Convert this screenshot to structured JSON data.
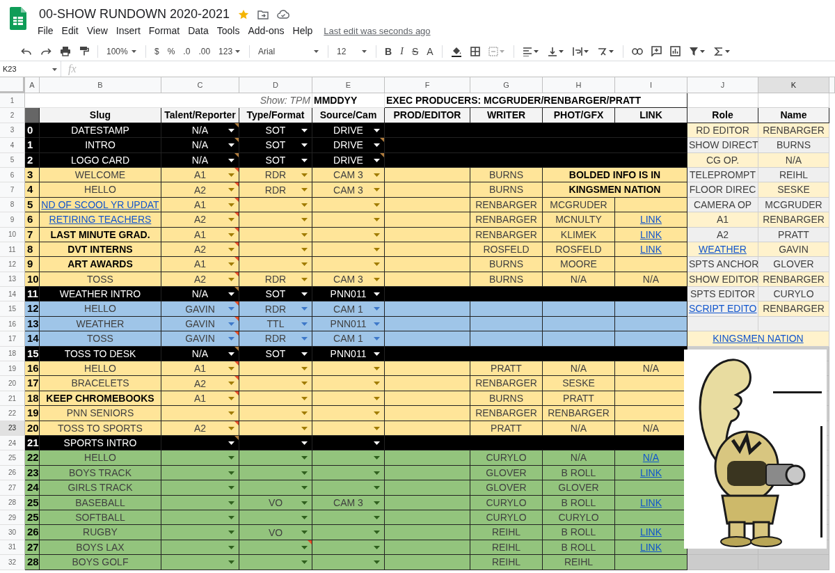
{
  "document": {
    "title": "00-SHOW RUNDOWN 2020-2021",
    "starred": true,
    "last_edit": "Last edit was seconds ago"
  },
  "menu": [
    "File",
    "Edit",
    "View",
    "Insert",
    "Format",
    "Data",
    "Tools",
    "Add-ons",
    "Help"
  ],
  "toolbar": {
    "zoom": "100%",
    "currency": "$",
    "percent": "%",
    "decrease_decimals": ".0",
    "increase_decimals": ".00",
    "more_formats": "123",
    "font": "Arial",
    "font_size": "12",
    "bold": "B",
    "italic": "I",
    "strikethrough": "S",
    "text_color": "A"
  },
  "formula_bar": {
    "cell": "K23",
    "fx": "fx"
  },
  "columns": [
    {
      "label": "A",
      "selected": false
    },
    {
      "label": "B",
      "selected": false
    },
    {
      "label": "C",
      "selected": false
    },
    {
      "label": "D",
      "selected": false
    },
    {
      "label": "E",
      "selected": false
    },
    {
      "label": "F",
      "selected": false
    },
    {
      "label": "G",
      "selected": false
    },
    {
      "label": "H",
      "selected": false
    },
    {
      "label": "I",
      "selected": false
    },
    {
      "label": "J",
      "selected": false
    },
    {
      "label": "K",
      "selected": true
    }
  ],
  "title_row": {
    "row": "1",
    "show_label": "Show: TPM",
    "date": "MMDDYY",
    "producers": "EXEC PRODUCERS: MCGRUDER/RENBARGER/PRATT"
  },
  "header_row": {
    "row": "2",
    "headings": [
      "Slug",
      "Talent/Reporter",
      "Type/Format",
      "Source/Cam",
      "PROD/EDITOR",
      "WRITER",
      "PHOT/GFX",
      "LINK",
      "Role",
      "Name"
    ]
  },
  "rows": [
    {
      "row": "3",
      "selected": false,
      "kind": "section",
      "number": "0",
      "slug": {
        "text": "DATESTAMP",
        "kind": "plain"
      },
      "talent": {
        "value": "N/A",
        "flagged": true
      },
      "type": {
        "value": "SOT",
        "flagged": false
      },
      "source": {
        "value": "DRIVE",
        "flagged": false
      },
      "staff": {
        "role": {
          "text": "RD EDITOR",
          "linked": false,
          "color": "#fff2cc"
        },
        "name": {
          "text": "RENBARGER",
          "color": "#fff2cc"
        }
      }
    },
    {
      "row": "4",
      "selected": false,
      "kind": "section",
      "number": "1",
      "slug": {
        "text": "INTRO",
        "kind": "plain"
      },
      "talent": {
        "value": "N/A",
        "flagged": true
      },
      "type": {
        "value": "SOT",
        "flagged": false
      },
      "source": {
        "value": "DRIVE",
        "flagged": true
      },
      "staff": {
        "role": {
          "text": "SHOW DIRECT",
          "linked": false,
          "color": "#efefef"
        },
        "name": {
          "text": "BURNS",
          "color": "#efefef"
        }
      }
    },
    {
      "row": "5",
      "selected": false,
      "kind": "section",
      "number": "2",
      "slug": {
        "text": "LOGO CARD",
        "kind": "plain"
      },
      "talent": {
        "value": "N/A",
        "flagged": true
      },
      "type": {
        "value": "SOT",
        "flagged": false
      },
      "source": {
        "value": "DRIVE",
        "flagged": true
      },
      "staff": {
        "role": {
          "text": "CG OP.",
          "linked": false,
          "color": "#fff2cc"
        },
        "name": {
          "text": "N/A",
          "color": "#fff2cc"
        }
      }
    },
    {
      "row": "6",
      "selected": false,
      "kind": "yellow",
      "number": "3",
      "slug": {
        "text": "WELCOME",
        "kind": "plain"
      },
      "talent": {
        "value": "A1",
        "flagged": true
      },
      "type": {
        "value": "RDR",
        "flagged": false
      },
      "source": {
        "value": "CAM 3",
        "flagged": false
      },
      "writer": "BURNS",
      "banner": "BOLDED INFO IS IN",
      "staff": {
        "role": {
          "text": "TELEPROMPT",
          "linked": false,
          "color": "#efefef"
        },
        "name": {
          "text": "REIHL",
          "color": "#efefef"
        }
      }
    },
    {
      "row": "7",
      "selected": false,
      "kind": "yellow",
      "number": "4",
      "slug": {
        "text": "HELLO",
        "kind": "plain"
      },
      "talent": {
        "value": "A2",
        "flagged": true
      },
      "type": {
        "value": "RDR",
        "flagged": false
      },
      "source": {
        "value": "CAM 3",
        "flagged": false
      },
      "writer": "BURNS",
      "banner": "KINGSMEN NATION",
      "staff": {
        "role": {
          "text": "FLOOR DIREC",
          "linked": false,
          "color": "#efefef"
        },
        "name": {
          "text": "SESKE",
          "color": "#fff2cc"
        }
      }
    },
    {
      "row": "8",
      "selected": false,
      "kind": "yellow",
      "number": "5",
      "slug": {
        "text": "ND OF SCOOL YR UPDAT",
        "kind": "link"
      },
      "talent": {
        "value": "A1",
        "flagged": true
      },
      "type": {
        "flagged": false
      },
      "source": {
        "flagged": false
      },
      "writer": "RENBARGER",
      "phot": "MCGRUDER",
      "staff": {
        "role": {
          "text": "CAMERA OP",
          "linked": false,
          "color": "#efefef"
        },
        "name": {
          "text": "MCGRUDER",
          "color": "#efefef"
        }
      }
    },
    {
      "row": "9",
      "selected": false,
      "kind": "yellow",
      "number": "6",
      "slug": {
        "text": "RETIRING TEACHERS",
        "kind": "link"
      },
      "talent": {
        "value": "A2",
        "flagged": true
      },
      "type": {
        "flagged": false
      },
      "source": {
        "flagged": false
      },
      "writer": "RENBARGER",
      "phot": "MCNULTY",
      "link": {
        "text": "LINK",
        "linked": true
      },
      "staff": {
        "role": {
          "text": "A1",
          "linked": false,
          "color": "#fff2cc"
        },
        "name": {
          "text": "RENBARGER",
          "color": "#fff2cc"
        }
      }
    },
    {
      "row": "10",
      "selected": false,
      "kind": "yellow",
      "number": "7",
      "slug": {
        "text": "LAST MINUTE GRAD.",
        "kind": "bold"
      },
      "talent": {
        "value": "A1",
        "flagged": true
      },
      "type": {
        "flagged": false
      },
      "source": {
        "flagged": false
      },
      "writer": "RENBARGER",
      "phot": "KLIMEK",
      "link": {
        "text": "LINK",
        "linked": true
      },
      "staff": {
        "role": {
          "text": "A2",
          "linked": false,
          "color": "#efefef"
        },
        "name": {
          "text": "PRATT",
          "color": "#efefef"
        }
      }
    },
    {
      "row": "11",
      "selected": false,
      "kind": "yellow",
      "number": "8",
      "slug": {
        "text": "DVT INTERNS",
        "kind": "bold"
      },
      "talent": {
        "value": "A2",
        "flagged": true
      },
      "type": {
        "flagged": false
      },
      "source": {
        "flagged": false
      },
      "writer": "ROSFELD",
      "phot": "ROSFELD",
      "link": {
        "text": "LINK",
        "linked": true
      },
      "staff": {
        "role": {
          "text": "WEATHER",
          "linked": true,
          "color": "#fff2cc"
        },
        "name": {
          "text": "GAVIN",
          "color": "#fff2cc"
        }
      }
    },
    {
      "row": "12",
      "selected": false,
      "kind": "yellow",
      "number": "9",
      "slug": {
        "text": "ART AWARDS",
        "kind": "bold"
      },
      "talent": {
        "value": "A1",
        "flagged": true
      },
      "type": {
        "flagged": false
      },
      "source": {
        "flagged": false
      },
      "writer": "BURNS",
      "phot": "MOORE",
      "staff": {
        "role": {
          "text": "SPTS ANCHOR",
          "linked": false,
          "color": "#efefef"
        },
        "name": {
          "text": "GLOVER",
          "color": "#efefef"
        }
      }
    },
    {
      "row": "13",
      "selected": false,
      "kind": "yellow",
      "number": "10",
      "slug": {
        "text": "TOSS",
        "kind": "plain"
      },
      "talent": {
        "value": "A2",
        "flagged": true
      },
      "type": {
        "value": "RDR",
        "flagged": false
      },
      "source": {
        "value": "CAM 3",
        "flagged": false
      },
      "writer": "BURNS",
      "phot": "N/A",
      "link": {
        "text": "N/A",
        "linked": false
      },
      "staff": {
        "role": {
          "text": "SHOW EDITOR",
          "linked": false,
          "color": "#fff2cc"
        },
        "name": {
          "text": "RENBARGER",
          "color": "#fff2cc"
        }
      }
    },
    {
      "row": "14",
      "selected": false,
      "kind": "section",
      "number": "11",
      "slug": {
        "text": "WEATHER INTRO",
        "kind": "plain"
      },
      "talent": {
        "value": "N/A",
        "flagged": true
      },
      "type": {
        "value": "SOT",
        "flagged": false
      },
      "source": {
        "value": "PNN011",
        "flagged": false
      },
      "staff": {
        "role": {
          "text": "SPTS EDITOR",
          "linked": false,
          "color": "#efefef"
        },
        "name": {
          "text": "CURYLO",
          "color": "#efefef"
        }
      }
    },
    {
      "row": "15",
      "selected": false,
      "kind": "blue",
      "number": "12",
      "slug": {
        "text": "HELLO",
        "kind": "plain"
      },
      "talent": {
        "value": "GAVIN",
        "flagged": true
      },
      "type": {
        "value": "RDR",
        "flagged": false
      },
      "source": {
        "value": "CAM 1",
        "flagged": false
      },
      "staff": {
        "role": {
          "text": "SCRIPT EDITO",
          "linked": true,
          "color": "#efefef"
        },
        "name": {
          "text": "RENBARGER",
          "color": "#fff2cc"
        }
      }
    },
    {
      "row": "16",
      "selected": false,
      "kind": "blue",
      "number": "13",
      "slug": {
        "text": "WEATHER",
        "kind": "plain"
      },
      "talent": {
        "value": "GAVIN",
        "flagged": true
      },
      "type": {
        "value": "TTL",
        "flagged": false
      },
      "source": {
        "value": "PNN011",
        "flagged": false
      },
      "staff": {
        "role": {
          "color": "#efefef"
        },
        "name": {
          "color": "#efefef"
        }
      }
    },
    {
      "row": "17",
      "selected": false,
      "kind": "blue",
      "number": "14",
      "slug": {
        "text": "TOSS",
        "kind": "plain"
      },
      "talent": {
        "value": "GAVIN",
        "flagged": true
      },
      "type": {
        "value": "RDR",
        "flagged": false
      },
      "source": {
        "value": "CAM 1",
        "flagged": false
      },
      "staff_banner": "KINGSMEN NATION"
    },
    {
      "row": "18",
      "selected": false,
      "kind": "section",
      "number": "15",
      "slug": {
        "text": "TOSS TO DESK",
        "kind": "plain"
      },
      "talent": {
        "value": "N/A",
        "flagged": true
      },
      "type": {
        "value": "SOT",
        "flagged": false
      },
      "source": {
        "value": "PNN011",
        "flagged": false
      }
    },
    {
      "row": "19",
      "selected": false,
      "kind": "yellow",
      "number": "16",
      "slug": {
        "text": "HELLO",
        "kind": "plain"
      },
      "talent": {
        "value": "A1",
        "flagged": true
      },
      "type": {
        "flagged": false
      },
      "source": {
        "flagged": false
      },
      "writer": "PRATT",
      "phot": "N/A",
      "link": {
        "text": "N/A",
        "linked": false
      }
    },
    {
      "row": "20",
      "selected": false,
      "kind": "yellow",
      "number": "17",
      "slug": {
        "text": "BRACELETS",
        "kind": "plain"
      },
      "talent": {
        "value": "A2",
        "flagged": true
      },
      "type": {
        "flagged": false
      },
      "source": {
        "flagged": false
      },
      "writer": "RENBARGER",
      "phot": "SESKE"
    },
    {
      "row": "21",
      "selected": false,
      "kind": "yellow",
      "number": "18",
      "slug": {
        "text": "KEEP CHROMEBOOKS",
        "kind": "bold"
      },
      "talent": {
        "value": "A1",
        "flagged": true
      },
      "type": {
        "flagged": false
      },
      "source": {
        "flagged": false
      },
      "writer": "BURNS",
      "phot": "PRATT"
    },
    {
      "row": "22",
      "selected": false,
      "kind": "yellow",
      "number": "19",
      "slug": {
        "text": "PNN SENIORS",
        "kind": "plain"
      },
      "talent": {
        "flagged": false
      },
      "type": {
        "flagged": false
      },
      "source": {
        "flagged": false
      },
      "writer": "RENBARGER",
      "phot": "RENBARGER"
    },
    {
      "row": "23",
      "selected": true,
      "kind": "yellow",
      "number": "20",
      "slug": {
        "text": "TOSS TO SPORTS",
        "kind": "plain"
      },
      "talent": {
        "value": "A2",
        "flagged": true
      },
      "type": {
        "flagged": false
      },
      "source": {
        "flagged": false
      },
      "writer": "PRATT",
      "phot": "N/A",
      "link": {
        "text": "N/A",
        "linked": false
      }
    },
    {
      "row": "24",
      "selected": false,
      "kind": "section",
      "number": "21",
      "slug": {
        "text": "SPORTS INTRO",
        "kind": "plain"
      },
      "talent": {
        "flagged": true
      },
      "type": {
        "flagged": false
      },
      "source": {
        "flagged": false
      }
    },
    {
      "row": "25",
      "selected": false,
      "kind": "green",
      "number": "22",
      "slug": {
        "text": "HELLO",
        "kind": "plain"
      },
      "talent": {
        "flagged": false
      },
      "type": {
        "flagged": false
      },
      "source": {
        "flagged": false
      },
      "writer": "CURYLO",
      "phot": "N/A",
      "link": {
        "text": "N/A",
        "linked": true
      }
    },
    {
      "row": "26",
      "selected": false,
      "kind": "green",
      "number": "23",
      "slug": {
        "text": "BOYS TRACK",
        "kind": "plain"
      },
      "talent": {
        "flagged": false
      },
      "type": {
        "flagged": false
      },
      "source": {
        "flagged": false
      },
      "writer": "GLOVER",
      "phot": "B ROLL",
      "link": {
        "text": "LINK",
        "linked": true
      }
    },
    {
      "row": "27",
      "selected": false,
      "kind": "green",
      "number": "24",
      "slug": {
        "text": "GIRLS TRACK",
        "kind": "plain"
      },
      "talent": {
        "flagged": false
      },
      "type": {
        "flagged": false
      },
      "source": {
        "flagged": false
      },
      "writer": "GLOVER",
      "phot": "GLOVER"
    },
    {
      "row": "28",
      "selected": false,
      "kind": "green",
      "number": "25",
      "slug": {
        "text": "BASEBALL",
        "kind": "plain"
      },
      "talent": {
        "flagged": false
      },
      "type": {
        "value": "VO",
        "flagged": false
      },
      "source": {
        "value": "CAM 3",
        "flagged": false
      },
      "writer": "CURYLO",
      "phot": "B ROLL",
      "link": {
        "text": "LINK",
        "linked": true
      }
    },
    {
      "row": "29",
      "selected": false,
      "kind": "green",
      "number": "25",
      "slug": {
        "text": "SOFTBALL",
        "kind": "plain"
      },
      "talent": {
        "flagged": false
      },
      "type": {
        "flagged": false
      },
      "source": {
        "flagged": false
      },
      "writer": "CURYLO",
      "phot": "CURYLO"
    },
    {
      "row": "30",
      "selected": false,
      "kind": "green",
      "number": "26",
      "slug": {
        "text": "RUGBY",
        "kind": "plain"
      },
      "talent": {
        "flagged": false
      },
      "type": {
        "value": "VO",
        "flagged": false
      },
      "source": {
        "flagged": false
      },
      "writer": "REIHL",
      "phot": "B ROLL",
      "link": {
        "text": "LINK",
        "linked": true
      }
    },
    {
      "row": "31",
      "selected": false,
      "kind": "green",
      "number": "27",
      "slug": {
        "text": "BOYS LAX",
        "kind": "plain"
      },
      "talent": {
        "flagged": false
      },
      "type": {
        "flagged": true
      },
      "source": {
        "flagged": false
      },
      "writer": "REIHL",
      "phot": "B ROLL",
      "link": {
        "text": "LINK",
        "linked": true
      }
    },
    {
      "row": "32",
      "selected": false,
      "kind": "green",
      "number": "28",
      "slug": {
        "text": "BOYS GOLF",
        "kind": "plain"
      },
      "talent": {
        "flagged": false
      },
      "type": {
        "flagged": false
      },
      "source": {
        "flagged": false
      },
      "writer": "REIHL",
      "phot": "REIHL"
    }
  ],
  "logo_image": {
    "kind": "picture"
  }
}
